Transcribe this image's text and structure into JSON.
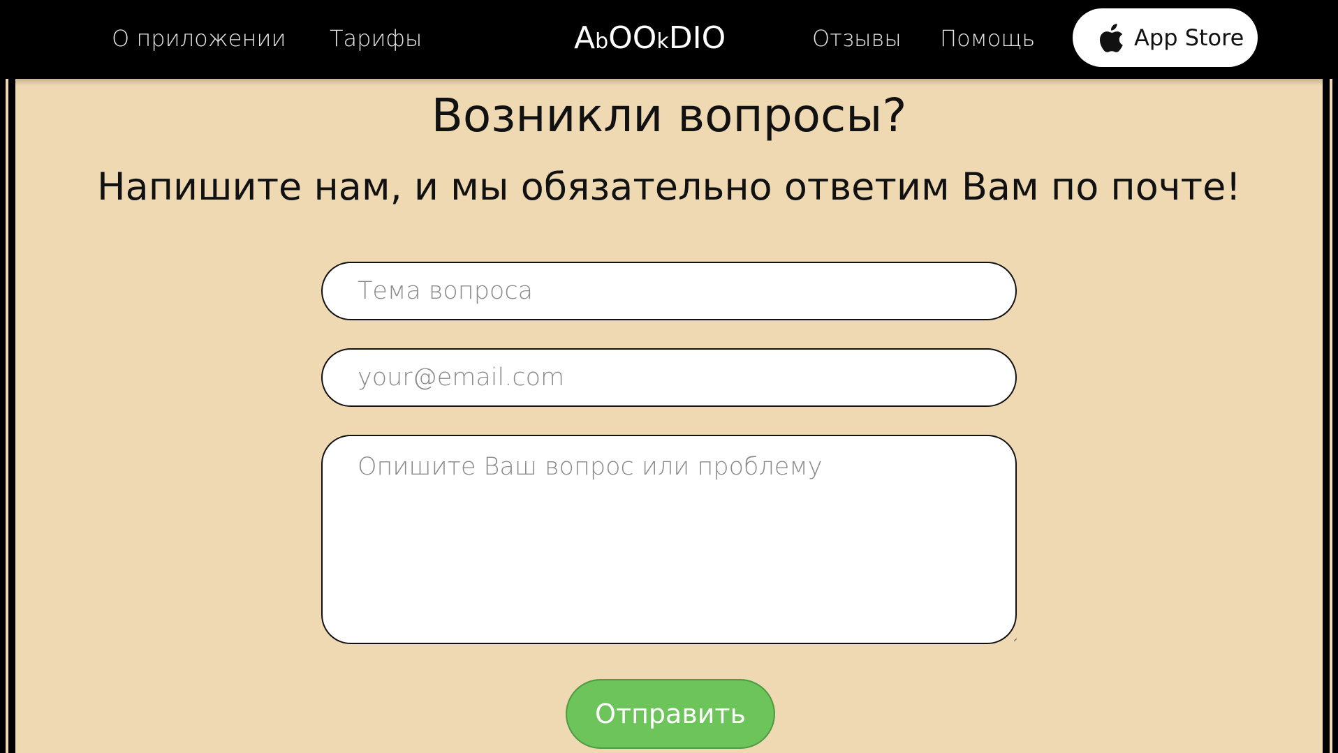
{
  "header": {
    "nav_left": [
      {
        "label": "О приложении"
      },
      {
        "label": "Тарифы"
      }
    ],
    "logo": {
      "parts": [
        "A",
        "b",
        "OO",
        "k",
        "DIO"
      ]
    },
    "nav_right": [
      {
        "label": "Отзывы"
      },
      {
        "label": "Помощь"
      }
    ],
    "appstore": {
      "label": "App  Store",
      "icon": "apple-icon"
    }
  },
  "main": {
    "title": "Возникли вопросы?",
    "subtitle": "Напишите нам, и мы обязательно ответим Вам по почте!",
    "form": {
      "subject_placeholder": "Тема вопроса",
      "subject_value": "",
      "email_placeholder": "your@email.com",
      "email_value": "",
      "message_placeholder": "Опишите Ваш вопрос или проблему",
      "message_value": "",
      "submit_label": "Отправить"
    }
  },
  "colors": {
    "header_bg": "#000000",
    "panel_bg": "#eed9b3",
    "submit_bg": "#6cc45a",
    "field_bg": "#ffffff"
  }
}
